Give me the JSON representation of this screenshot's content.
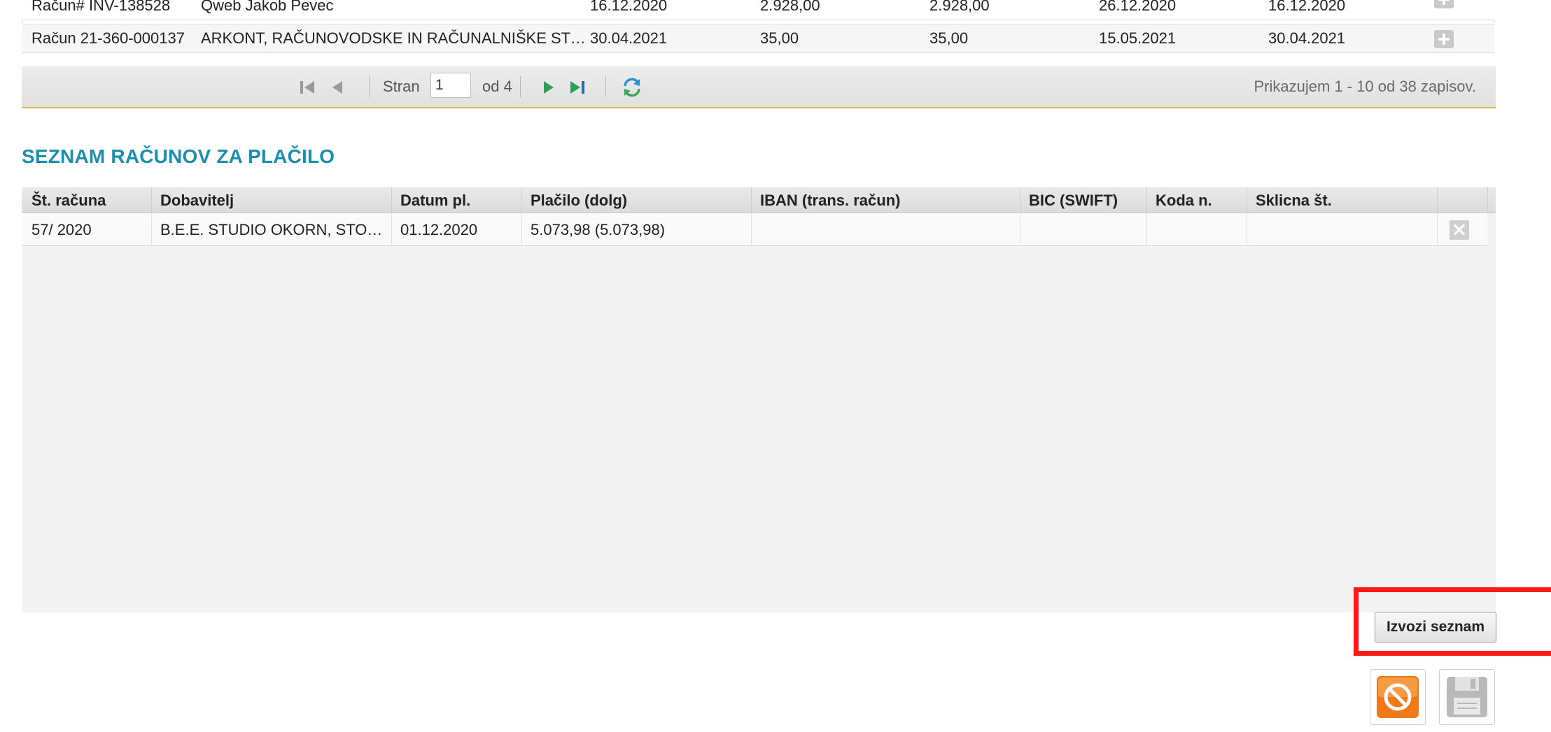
{
  "top_grid": {
    "rows": [
      {
        "no": "Račun# INV-138528",
        "supplier": "Qweb Jakob Pevec",
        "date1": "16.12.2020",
        "amount1": "2.928,00",
        "amount2": "2.928,00",
        "date2": "26.12.2020",
        "date3": "16.12.2020"
      },
      {
        "no": "Račun 21-360-000137",
        "supplier": "ARKONT, RAČUNOVODSKE IN RAČUNALNIŠKE STORITVE",
        "date1": "30.04.2021",
        "amount1": "35,00",
        "amount2": "35,00",
        "date2": "15.05.2021",
        "date3": "30.04.2021"
      }
    ]
  },
  "pager": {
    "page_label": "Stran",
    "page_value": "1",
    "of_label": "od 4",
    "info": "Prikazujem 1 - 10 od 38 zapisov."
  },
  "payments": {
    "title": "SEZNAM RAČUNOV ZA PLAČILO",
    "columns": [
      "Št. računa",
      "Dobavitelj",
      "Datum pl.",
      "Plačilo (dolg)",
      "IBAN (trans. račun)",
      "BIC (SWIFT)",
      "Koda n.",
      "Sklicna št."
    ],
    "rows": [
      {
        "no": "57/ 2020",
        "supplier": "B.E.E. STUDIO OKORN, STO…",
        "date": "01.12.2020",
        "payment": "5.073,98 (5.073,98)",
        "iban": "",
        "bic": "",
        "code": "",
        "ref": ""
      }
    ]
  },
  "export_label": "Izvozi seznam",
  "colors": {
    "accent": "#1c8fae",
    "highlight": "#ff1a1a",
    "pager_underline": "#e2b64d",
    "cancel": "#f07a1a"
  },
  "icons": [
    "first-page-icon",
    "prev-page-icon",
    "next-page-icon",
    "last-page-icon",
    "refresh-icon",
    "add-icon",
    "delete-icon",
    "cancel-icon",
    "save-icon"
  ]
}
